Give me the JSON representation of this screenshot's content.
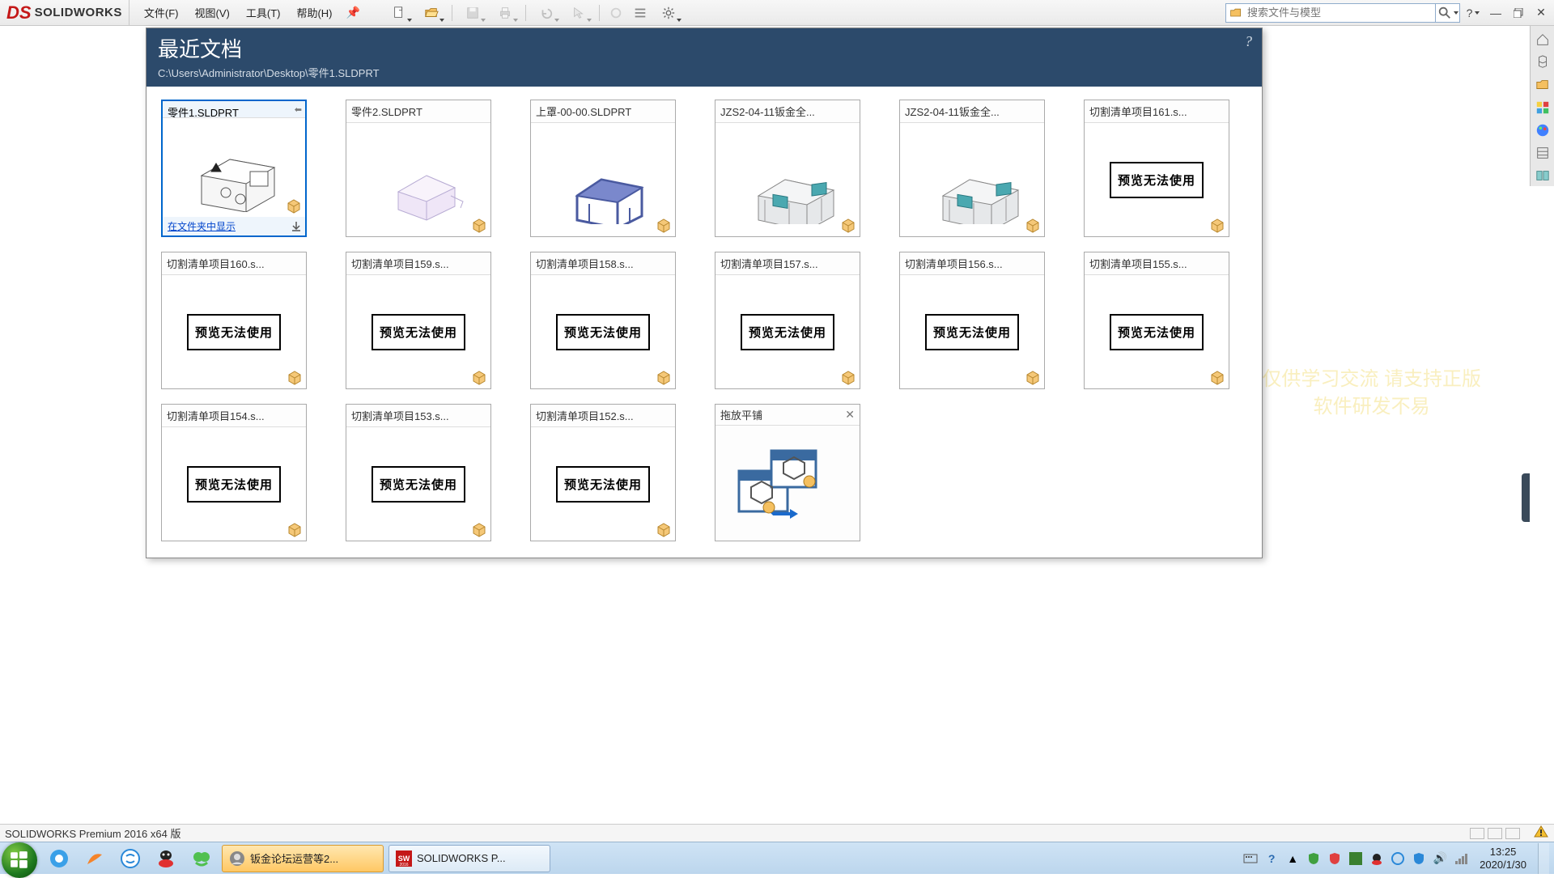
{
  "app": {
    "logo_text": "SOLIDWORKS"
  },
  "menu": {
    "file": "文件(F)",
    "view": "视图(V)",
    "tools": "工具(T)",
    "help": "帮助(H)"
  },
  "search": {
    "placeholder": "搜索文件与模型"
  },
  "recent": {
    "title": "最近文档",
    "path": "C:\\Users\\Administrator\\Desktop\\零件1.SLDPRT",
    "show_in_folder": "在文件夹中显示",
    "no_preview": "预览无法使用",
    "docs": [
      {
        "name": "零件1.SLDPRT",
        "preview": "part1",
        "selected": true
      },
      {
        "name": "零件2.SLDPRT",
        "preview": "part2"
      },
      {
        "name": "上罩-00-00.SLDPRT",
        "preview": "frame"
      },
      {
        "name": "JZS2-04-11钣金全...",
        "preview": "asm"
      },
      {
        "name": "JZS2-04-11钣金全...",
        "preview": "asm"
      },
      {
        "name": "切割清单项目161.s...",
        "preview": "none"
      },
      {
        "name": "切割清单项目160.s...",
        "preview": "none"
      },
      {
        "name": "切割清单项目159.s...",
        "preview": "none"
      },
      {
        "name": "切割清单项目158.s...",
        "preview": "none"
      },
      {
        "name": "切割清单项目157.s...",
        "preview": "none"
      },
      {
        "name": "切割清单项目156.s...",
        "preview": "none"
      },
      {
        "name": "切割清单项目155.s...",
        "preview": "none"
      },
      {
        "name": "切割清单项目154.s...",
        "preview": "none"
      },
      {
        "name": "切割清单项目153.s...",
        "preview": "none"
      },
      {
        "name": "切割清单项目152.s...",
        "preview": "none"
      }
    ],
    "drag_tile": {
      "title": "拖放平铺"
    }
  },
  "status": {
    "text": "SOLIDWORKS Premium 2016 x64 版"
  },
  "taskbar": {
    "apps": [
      {
        "label": "钣金论坛运营等2...",
        "active": true,
        "icon": "chat"
      },
      {
        "label": "SOLIDWORKS P...",
        "active": false,
        "icon": "sw"
      }
    ],
    "clock_time": "13:25",
    "clock_date": "2020/1/30"
  },
  "watermark": {
    "line1": "仅供学习交流 请支持正版",
    "line2": "软件研发不易"
  }
}
